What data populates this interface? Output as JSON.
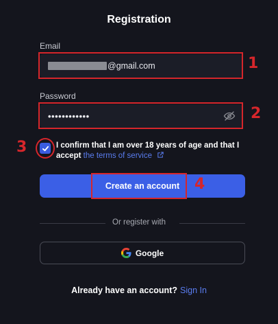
{
  "form": {
    "title": "Registration",
    "email_label": "Email",
    "email_value": "@gmail.com",
    "password_label": "Password",
    "password_value": "••••••••••••",
    "terms_checked": true,
    "confirm_text": "I confirm that I am over 18 years of age and that I accept",
    "terms_link": "the terms of service",
    "create_button": "Create an account",
    "or_register": "Or register with",
    "google_button": "Google",
    "already_text": "Already have an account?",
    "sign_in_link": "Sign In"
  },
  "annotations": [
    "1",
    "2",
    "3",
    "4"
  ],
  "colors": {
    "background": "#14151d",
    "field": "#1b1d27",
    "accent": "#3b5fe6",
    "link": "#5a7df0",
    "highlight": "#d6262b"
  },
  "icons": [
    "eye-off-icon",
    "check-icon",
    "external-link-icon",
    "google-logo-icon"
  ]
}
